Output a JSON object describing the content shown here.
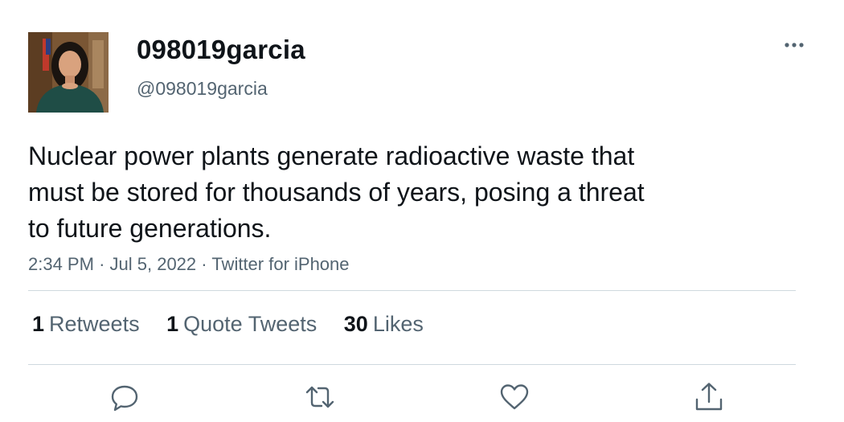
{
  "user": {
    "display_name": "098019garcia",
    "handle": "@098019garcia",
    "avatar": "profile-photo"
  },
  "tweet": {
    "text_lines": [
      "Nuclear power plants generate radioactive waste that",
      "must be stored for thousands of years, posing a threat",
      "to future generations."
    ],
    "time": "2:34 PM",
    "date": "Jul 5, 2022",
    "source": "Twitter for iPhone",
    "separator": "·"
  },
  "stats": [
    {
      "count": "1",
      "label": "Retweets"
    },
    {
      "count": "1",
      "label": "Quote Tweets"
    },
    {
      "count": "30",
      "label": "Likes"
    }
  ],
  "actions": [
    "reply-icon",
    "retweet-icon",
    "like-icon",
    "share-icon"
  ],
  "colors": {
    "text": "#0f1419",
    "secondary": "#536471",
    "divider": "#cfd9de"
  }
}
